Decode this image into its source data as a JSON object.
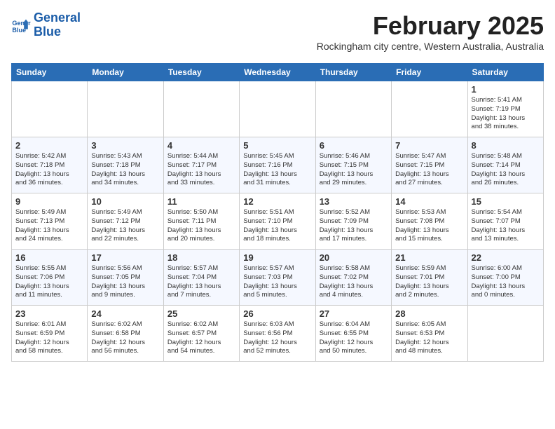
{
  "logo": {
    "line1": "General",
    "line2": "Blue"
  },
  "title": "February 2025",
  "subtitle": "Rockingham city centre, Western Australia, Australia",
  "days_of_week": [
    "Sunday",
    "Monday",
    "Tuesday",
    "Wednesday",
    "Thursday",
    "Friday",
    "Saturday"
  ],
  "weeks": [
    [
      {
        "num": "",
        "info": ""
      },
      {
        "num": "",
        "info": ""
      },
      {
        "num": "",
        "info": ""
      },
      {
        "num": "",
        "info": ""
      },
      {
        "num": "",
        "info": ""
      },
      {
        "num": "",
        "info": ""
      },
      {
        "num": "1",
        "info": "Sunrise: 5:41 AM\nSunset: 7:19 PM\nDaylight: 13 hours\nand 38 minutes."
      }
    ],
    [
      {
        "num": "2",
        "info": "Sunrise: 5:42 AM\nSunset: 7:18 PM\nDaylight: 13 hours\nand 36 minutes."
      },
      {
        "num": "3",
        "info": "Sunrise: 5:43 AM\nSunset: 7:18 PM\nDaylight: 13 hours\nand 34 minutes."
      },
      {
        "num": "4",
        "info": "Sunrise: 5:44 AM\nSunset: 7:17 PM\nDaylight: 13 hours\nand 33 minutes."
      },
      {
        "num": "5",
        "info": "Sunrise: 5:45 AM\nSunset: 7:16 PM\nDaylight: 13 hours\nand 31 minutes."
      },
      {
        "num": "6",
        "info": "Sunrise: 5:46 AM\nSunset: 7:15 PM\nDaylight: 13 hours\nand 29 minutes."
      },
      {
        "num": "7",
        "info": "Sunrise: 5:47 AM\nSunset: 7:15 PM\nDaylight: 13 hours\nand 27 minutes."
      },
      {
        "num": "8",
        "info": "Sunrise: 5:48 AM\nSunset: 7:14 PM\nDaylight: 13 hours\nand 26 minutes."
      }
    ],
    [
      {
        "num": "9",
        "info": "Sunrise: 5:49 AM\nSunset: 7:13 PM\nDaylight: 13 hours\nand 24 minutes."
      },
      {
        "num": "10",
        "info": "Sunrise: 5:49 AM\nSunset: 7:12 PM\nDaylight: 13 hours\nand 22 minutes."
      },
      {
        "num": "11",
        "info": "Sunrise: 5:50 AM\nSunset: 7:11 PM\nDaylight: 13 hours\nand 20 minutes."
      },
      {
        "num": "12",
        "info": "Sunrise: 5:51 AM\nSunset: 7:10 PM\nDaylight: 13 hours\nand 18 minutes."
      },
      {
        "num": "13",
        "info": "Sunrise: 5:52 AM\nSunset: 7:09 PM\nDaylight: 13 hours\nand 17 minutes."
      },
      {
        "num": "14",
        "info": "Sunrise: 5:53 AM\nSunset: 7:08 PM\nDaylight: 13 hours\nand 15 minutes."
      },
      {
        "num": "15",
        "info": "Sunrise: 5:54 AM\nSunset: 7:07 PM\nDaylight: 13 hours\nand 13 minutes."
      }
    ],
    [
      {
        "num": "16",
        "info": "Sunrise: 5:55 AM\nSunset: 7:06 PM\nDaylight: 13 hours\nand 11 minutes."
      },
      {
        "num": "17",
        "info": "Sunrise: 5:56 AM\nSunset: 7:05 PM\nDaylight: 13 hours\nand 9 minutes."
      },
      {
        "num": "18",
        "info": "Sunrise: 5:57 AM\nSunset: 7:04 PM\nDaylight: 13 hours\nand 7 minutes."
      },
      {
        "num": "19",
        "info": "Sunrise: 5:57 AM\nSunset: 7:03 PM\nDaylight: 13 hours\nand 5 minutes."
      },
      {
        "num": "20",
        "info": "Sunrise: 5:58 AM\nSunset: 7:02 PM\nDaylight: 13 hours\nand 4 minutes."
      },
      {
        "num": "21",
        "info": "Sunrise: 5:59 AM\nSunset: 7:01 PM\nDaylight: 13 hours\nand 2 minutes."
      },
      {
        "num": "22",
        "info": "Sunrise: 6:00 AM\nSunset: 7:00 PM\nDaylight: 13 hours\nand 0 minutes."
      }
    ],
    [
      {
        "num": "23",
        "info": "Sunrise: 6:01 AM\nSunset: 6:59 PM\nDaylight: 12 hours\nand 58 minutes."
      },
      {
        "num": "24",
        "info": "Sunrise: 6:02 AM\nSunset: 6:58 PM\nDaylight: 12 hours\nand 56 minutes."
      },
      {
        "num": "25",
        "info": "Sunrise: 6:02 AM\nSunset: 6:57 PM\nDaylight: 12 hours\nand 54 minutes."
      },
      {
        "num": "26",
        "info": "Sunrise: 6:03 AM\nSunset: 6:56 PM\nDaylight: 12 hours\nand 52 minutes."
      },
      {
        "num": "27",
        "info": "Sunrise: 6:04 AM\nSunset: 6:55 PM\nDaylight: 12 hours\nand 50 minutes."
      },
      {
        "num": "28",
        "info": "Sunrise: 6:05 AM\nSunset: 6:53 PM\nDaylight: 12 hours\nand 48 minutes."
      },
      {
        "num": "",
        "info": ""
      }
    ]
  ]
}
